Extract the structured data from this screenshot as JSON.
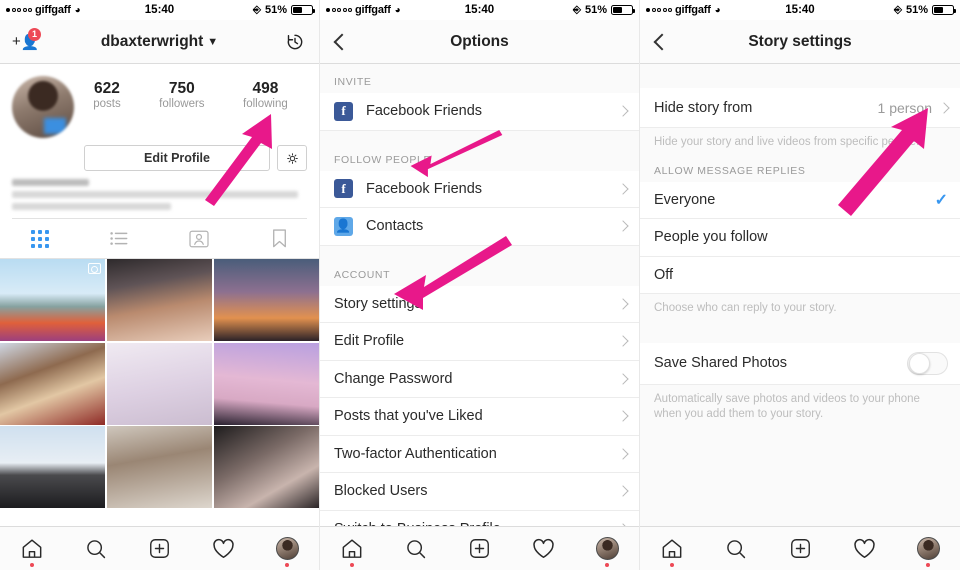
{
  "accent": {
    "arrow_pink": "#e8188a",
    "link_blue": "#3897f0",
    "badge_red": "#ed4956",
    "facebook_blue": "#3b5998"
  },
  "status_bar": {
    "carrier": "giffgaff",
    "time": "15:40",
    "battery_text": "51%",
    "battery_level": 51,
    "signal_dots_total": 5,
    "signal_dots_filled": 1,
    "wifi_icon": "wifi-icon",
    "location_icon": "location-icon"
  },
  "screen1": {
    "nav": {
      "title": "dbaxterwright",
      "chevron": "⌄",
      "add_user_icon": "add-user-icon",
      "badge_count": "1",
      "archive_icon": "archive-history-icon"
    },
    "stats": [
      {
        "num": "622",
        "label": "posts"
      },
      {
        "num": "750",
        "label": "followers"
      },
      {
        "num": "498",
        "label": "following"
      }
    ],
    "edit_profile_label": "Edit Profile",
    "gear_icon": "gear-icon",
    "tabs": [
      {
        "name": "grid-view-icon"
      },
      {
        "name": "list-view-icon"
      },
      {
        "name": "tagged-photos-icon"
      },
      {
        "name": "saved-bookmark-icon"
      }
    ]
  },
  "screen2": {
    "nav": {
      "title": "Options",
      "back_icon": "back-chevron-icon"
    },
    "sections": [
      {
        "header": "INVITE",
        "rows": [
          {
            "label": "Facebook Friends",
            "icon": "facebook-icon"
          }
        ]
      },
      {
        "header": "FOLLOW PEOPLE",
        "rows": [
          {
            "label": "Facebook Friends",
            "icon": "facebook-icon"
          },
          {
            "label": "Contacts",
            "icon": "contacts-icon"
          }
        ]
      },
      {
        "header": "ACCOUNT",
        "rows": [
          {
            "label": "Story settings",
            "icon": ""
          },
          {
            "label": "Edit Profile",
            "icon": ""
          },
          {
            "label": "Change Password",
            "icon": ""
          },
          {
            "label": "Posts that you've Liked",
            "icon": ""
          },
          {
            "label": "Two-factor Authentication",
            "icon": ""
          },
          {
            "label": "Blocked Users",
            "icon": ""
          },
          {
            "label": "Switch to Business Profile",
            "icon": ""
          }
        ]
      }
    ]
  },
  "screen3": {
    "nav": {
      "title": "Story settings",
      "back_icon": "back-chevron-icon"
    },
    "hide_story": {
      "label": "Hide story from",
      "value": "1 person"
    },
    "hide_story_note": "Hide your story and live videos from specific people.",
    "replies_header": "ALLOW MESSAGE REPLIES",
    "reply_options": [
      {
        "label": "Everyone",
        "selected": true
      },
      {
        "label": "People you follow",
        "selected": false
      },
      {
        "label": "Off",
        "selected": false
      }
    ],
    "replies_note": "Choose who can reply to your story.",
    "save_shared": {
      "label": "Save Shared Photos",
      "on": false
    },
    "save_shared_note": "Automatically save photos and videos to your phone when you add them to your story."
  },
  "tabbar": [
    {
      "name": "home-tab-icon",
      "dot": true
    },
    {
      "name": "search-tab-icon",
      "dot": false
    },
    {
      "name": "add-post-tab-icon",
      "dot": false
    },
    {
      "name": "activity-heart-tab-icon",
      "dot": false
    },
    {
      "name": "profile-tab-avatar",
      "dot": true
    }
  ]
}
